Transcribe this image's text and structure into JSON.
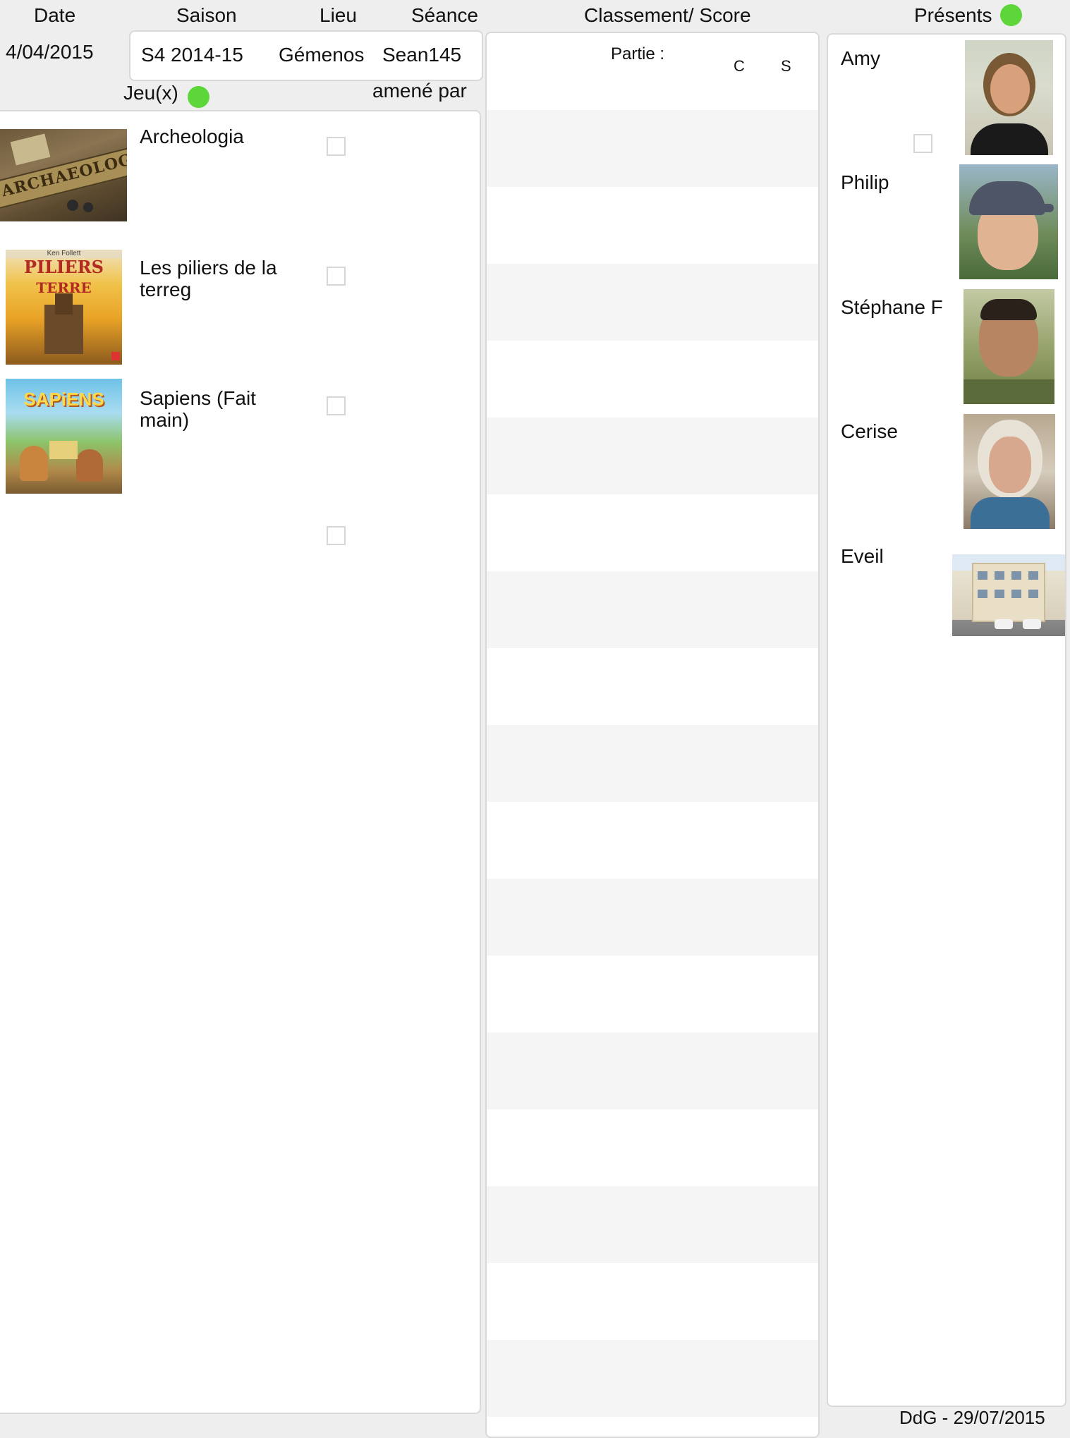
{
  "header": {
    "date_label": "Date",
    "saison_label": "Saison",
    "lieu_label": "Lieu",
    "seance_label": "Séance",
    "classement_label": "Classement/ Score",
    "presents_label": "Présents",
    "jeux_label": "Jeu(x)",
    "amene_par_label": "amené par"
  },
  "session": {
    "date": "4/04/2015",
    "saison": "S4 2014-15",
    "lieu": "Gémenos",
    "seance": "Sean145"
  },
  "score": {
    "partie_label": "Partie :",
    "col_c": "C",
    "col_s": "S"
  },
  "games": [
    {
      "title": "Archeologia",
      "box_art": "ARCHAEOLOGIA",
      "checked": false
    },
    {
      "title": "Les piliers de la terreg",
      "box_art": "PILIERS",
      "checked": false
    },
    {
      "title": "Sapiens (Fait main)",
      "box_art": "SAPiENS",
      "checked": false
    },
    {
      "title": "",
      "checked": false
    }
  ],
  "players": [
    {
      "name": "Amy",
      "checked": false
    },
    {
      "name": "Philip"
    },
    {
      "name": "Stéphane F"
    },
    {
      "name": "Cerise"
    },
    {
      "name": "Eveil"
    }
  ],
  "footer": {
    "text": "DdG - 29/07/2015"
  },
  "colors": {
    "accent_dot": "#5dd63a",
    "stripe": "#f5f5f5",
    "panel_border": "#d9d9d9"
  }
}
